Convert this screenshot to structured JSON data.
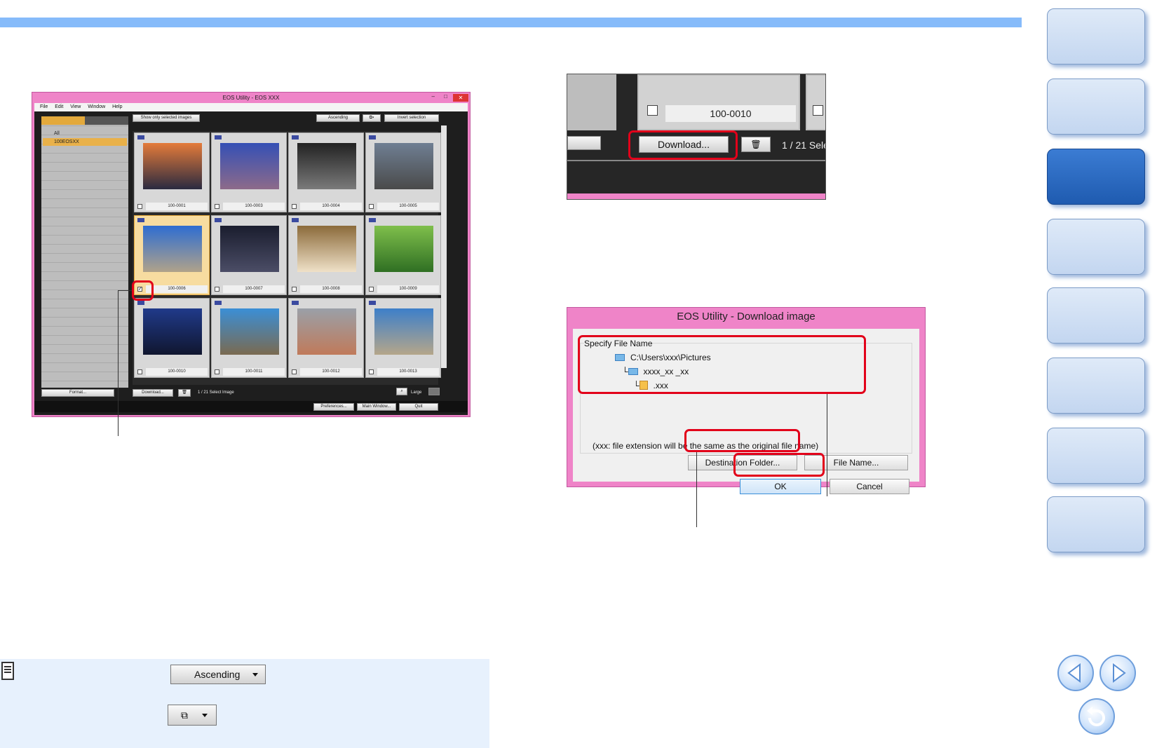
{
  "main_window": {
    "title": "EOS Utility - EOS XXX",
    "menu": [
      "File",
      "Edit",
      "View",
      "Window",
      "Help"
    ],
    "folders": {
      "all": "All",
      "selected": "100EOSXX"
    },
    "buttons": {
      "show_selected": "Show only selected images",
      "sort": "Ascending",
      "invert": "Invert selection",
      "format": "Format...",
      "download": "Download...",
      "size": "Large",
      "preferences": "Preferences...",
      "main_window": "Main Window...",
      "quit": "Quit"
    },
    "status": "1 / 21 Select Image",
    "thumbnails": [
      {
        "label": "100-0001",
        "checked": false,
        "colors": [
          "#e47b3a",
          "#2a2a40"
        ]
      },
      {
        "label": "100-0003",
        "checked": false,
        "colors": [
          "#3550b5",
          "#8d6a8a"
        ]
      },
      {
        "label": "100-0004",
        "checked": false,
        "colors": [
          "#222222",
          "#7a7a7a"
        ]
      },
      {
        "label": "100-0005",
        "checked": false,
        "colors": [
          "#6f7f93",
          "#4a4a4a"
        ]
      },
      {
        "label": "100-0006",
        "checked": true,
        "colors": [
          "#2e6dd1",
          "#b0a28a"
        ]
      },
      {
        "label": "100-0007",
        "checked": false,
        "colors": [
          "#1a1d2e",
          "#4b4d66"
        ]
      },
      {
        "label": "100-0008",
        "checked": false,
        "colors": [
          "#8b6a3a",
          "#efe1c8"
        ]
      },
      {
        "label": "100-0009",
        "checked": false,
        "colors": [
          "#7fbf4b",
          "#2f6f23"
        ]
      },
      {
        "label": "100-0010",
        "checked": false,
        "colors": [
          "#203a8a",
          "#10162f"
        ]
      },
      {
        "label": "100-0011",
        "checked": false,
        "colors": [
          "#3b8fd6",
          "#7a6a50"
        ]
      },
      {
        "label": "100-0012",
        "checked": false,
        "colors": [
          "#9aa0a8",
          "#c07a5a"
        ]
      },
      {
        "label": "100-0013",
        "checked": false,
        "colors": [
          "#3d7fc9",
          "#b5a68a"
        ]
      }
    ]
  },
  "download_zoom": {
    "image_label": "100-0010",
    "download_button": "Download...",
    "count": "1 / 21 Sele"
  },
  "download_dialog": {
    "title": "EOS Utility - Download image",
    "group_title": "Specify File Name",
    "path": "C:\\Users\\xxx\\Pictures",
    "subfolder": "xxxx_xx _xx",
    "file": ".xxx",
    "note": "(xxx: file extension will be the same as the original file name)",
    "destination_button": "Destination Folder...",
    "filename_button": "File Name...",
    "ok": "OK",
    "cancel": "Cancel"
  },
  "note_box": {
    "sort_button": "Ascending"
  },
  "colors": {
    "accent_band": "#86bbfa",
    "window_frame": "#ef84c8",
    "highlight": "#e2001a",
    "nav_active": "#1f5bb0"
  }
}
